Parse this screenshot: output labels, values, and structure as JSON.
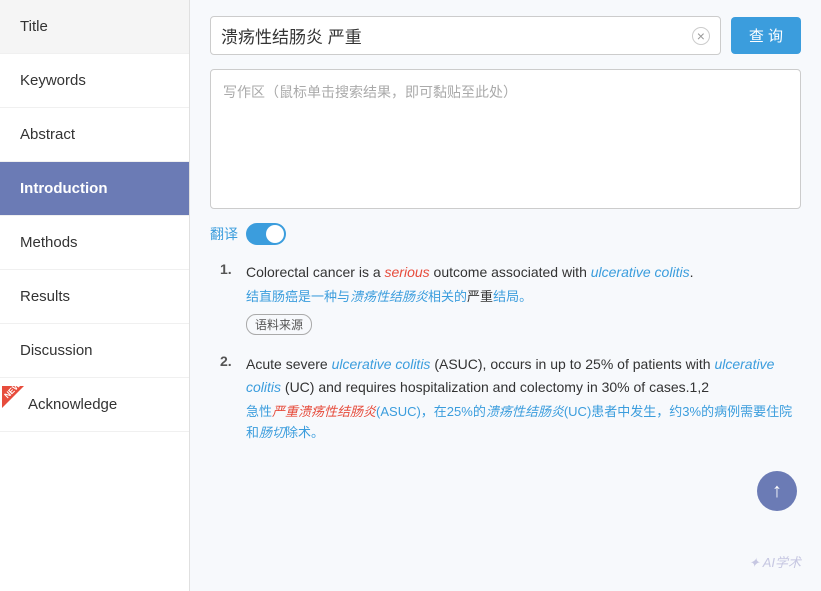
{
  "sidebar": {
    "items": [
      {
        "label": "Title",
        "id": "title",
        "active": false,
        "newBadge": false
      },
      {
        "label": "Keywords",
        "id": "keywords",
        "active": false,
        "newBadge": false
      },
      {
        "label": "Abstract",
        "id": "abstract",
        "active": false,
        "newBadge": false
      },
      {
        "label": "Introduction",
        "id": "introduction",
        "active": true,
        "newBadge": false
      },
      {
        "label": "Methods",
        "id": "methods",
        "active": false,
        "newBadge": false
      },
      {
        "label": "Results",
        "id": "results",
        "active": false,
        "newBadge": false
      },
      {
        "label": "Discussion",
        "id": "discussion",
        "active": false,
        "newBadge": false
      },
      {
        "label": "Acknowledge",
        "id": "acknowledge",
        "active": false,
        "newBadge": true
      }
    ]
  },
  "search": {
    "query": "溃疡性结肠炎 严重",
    "clear_label": "×",
    "button_label": "查 询"
  },
  "writing_area": {
    "placeholder": "写作区（鼠标单击搜索结果，即可黏贴至此处）"
  },
  "translate": {
    "label": "翻译"
  },
  "results": [
    {
      "num": "1.",
      "en_parts": [
        {
          "text": "Colorectal cancer is a ",
          "style": "normal"
        },
        {
          "text": "serious",
          "style": "italic-red"
        },
        {
          "text": " outcome associated with ",
          "style": "normal"
        },
        {
          "text": "ulcerative colitis",
          "style": "italic-blue"
        },
        {
          "text": ".",
          "style": "normal"
        }
      ],
      "cn": "结直肠癌是一种与溃疡性结肠炎相关的严重结局。",
      "cn_parts": [
        {
          "text": "结直肠癌是一种与",
          "style": "normal"
        },
        {
          "text": "溃疡性结肠炎",
          "style": "italic-blue"
        },
        {
          "text": "相关的",
          "style": "normal"
        },
        {
          "text": "严重",
          "style": "normal"
        },
        {
          "text": "结局。",
          "style": "normal"
        }
      ],
      "tag": "语料来源"
    },
    {
      "num": "2.",
      "en_parts": [
        {
          "text": "Acute severe ",
          "style": "normal"
        },
        {
          "text": "ulcerative colitis",
          "style": "italic-blue"
        },
        {
          "text": " (ASUC), occurs in up to 25% of patients with ",
          "style": "normal"
        },
        {
          "text": "ulcerative colitis",
          "style": "italic-blue"
        },
        {
          "text": " (UC) and requires hospitalization and colectomy in 30% of cases.1,2",
          "style": "normal"
        }
      ],
      "cn": "急性严重溃疡性结肠炎(ASUC)，在25%的溃疡性结肠炎(UC)患者中发生，约3%的病例需要住院和肠切除术。",
      "cn_parts": [
        {
          "text": "急性",
          "style": "normal"
        },
        {
          "text": "严重溃疡性结肠炎",
          "style": "italic-red"
        },
        {
          "text": "(ASUC)，在25%的",
          "style": "normal"
        },
        {
          "text": "溃疡性结肠炎",
          "style": "italic-blue"
        },
        {
          "text": "(UC)患者中发生，约3%的病例需要住院和",
          "style": "normal"
        },
        {
          "text": "肠切",
          "style": "italic-blue"
        },
        {
          "text": "除术。",
          "style": "normal"
        }
      ],
      "tag": null
    }
  ],
  "scroll_top_icon": "↑",
  "watermark": "AI学术"
}
